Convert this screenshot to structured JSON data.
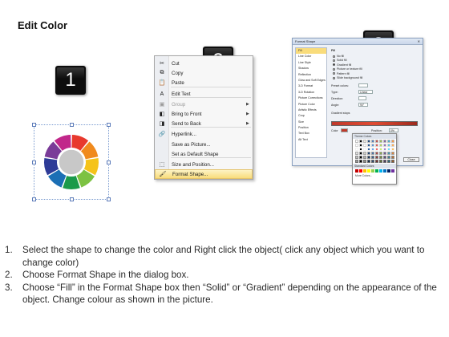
{
  "title": "Edit Color",
  "badges": [
    "1",
    "2",
    "3"
  ],
  "ring": {
    "segments": [
      "#e8392d",
      "#f08a1e",
      "#f5c31a",
      "#7cc242",
      "#1a9a4a",
      "#1b6fb5",
      "#2e3b97",
      "#7a3b98",
      "#c1278a"
    ],
    "center": "#c8c8c8"
  },
  "context_menu": {
    "items": [
      {
        "label": "Cut",
        "icon": "scissors-icon",
        "disabled": false,
        "submenu": false
      },
      {
        "label": "Copy",
        "icon": "copy-icon",
        "disabled": false,
        "submenu": false
      },
      {
        "label": "Paste",
        "icon": "paste-icon",
        "disabled": false,
        "submenu": false
      },
      {
        "label": "Edit Text",
        "icon": "edit-text-icon",
        "disabled": false,
        "submenu": false
      },
      {
        "label": "Group",
        "icon": "group-icon",
        "disabled": true,
        "submenu": true
      },
      {
        "label": "Bring to Front",
        "icon": "bring-to-front-icon",
        "disabled": false,
        "submenu": true
      },
      {
        "label": "Send to Back",
        "icon": "send-to-back-icon",
        "disabled": false,
        "submenu": true
      },
      {
        "label": "Hyperlink...",
        "icon": "hyperlink-icon",
        "disabled": false,
        "submenu": false
      },
      {
        "label": "Save as Picture...",
        "icon": "",
        "disabled": false,
        "submenu": false
      },
      {
        "label": "Set as Default Shape",
        "icon": "",
        "disabled": false,
        "submenu": false
      },
      {
        "label": "Size and Position...",
        "icon": "size-position-icon",
        "disabled": false,
        "submenu": false
      },
      {
        "label": "Format Shape...",
        "icon": "format-shape-icon",
        "disabled": false,
        "submenu": false
      }
    ],
    "highlighted": "Format Shape..."
  },
  "format_dialog": {
    "title": "Format Shape",
    "categories": [
      "Fill",
      "Line Color",
      "Line Style",
      "Shadow",
      "Reflection",
      "Glow and Soft Edges",
      "3-D Format",
      "3-D Rotation",
      "Picture Corrections",
      "Picture Color",
      "Artistic Effects",
      "Crop",
      "Size",
      "Position",
      "Text Box",
      "Alt Text"
    ],
    "fill_heading": "Fill",
    "fill_options": [
      "No fill",
      "Solid fill",
      "Gradient fill",
      "Picture or texture fill",
      "Pattern fill",
      "Slide background fill"
    ],
    "selected_fill": "Gradient fill",
    "fields": {
      "preset_colors": "Preset colors:",
      "type": "Type:",
      "type_value": "Linear",
      "direction": "Direction:",
      "angle": "Angle:",
      "angle_value": "90°",
      "gradient_stops": "Gradient stops",
      "color": "Color",
      "position": "Position:",
      "position_value": "0%",
      "brightness": "Brightness:",
      "transparency": "Transparency:",
      "rotate": "Rotate with shape"
    },
    "close_label": "Close"
  },
  "palette": {
    "theme_label": "Theme Colors",
    "standard_label": "Standard Colors",
    "more_label": "More Colors...",
    "recent": "Recent",
    "theme_row": [
      "#ffffff",
      "#000000",
      "#eeece1",
      "#1f497d",
      "#4f81bd",
      "#c0504d",
      "#9bbb59",
      "#8064a2",
      "#4bacc6",
      "#f79646"
    ],
    "standard": [
      "#c00000",
      "#ff0000",
      "#ffc000",
      "#ffff00",
      "#92d050",
      "#00b050",
      "#00b0f0",
      "#0070c0",
      "#002060",
      "#7030a0"
    ]
  },
  "steps": [
    {
      "num": "1.",
      "text": "Select the shape to change the color and Right click the object( click any object which you want to change color)"
    },
    {
      "num": "2.",
      "text": "Choose Format Shape in the dialog box."
    },
    {
      "num": "3.",
      "text": "Choose “Fill” in the Format Shape box then “Solid” or “Gradient” depending on the appearance of the object. Change colour as shown in the picture."
    }
  ]
}
